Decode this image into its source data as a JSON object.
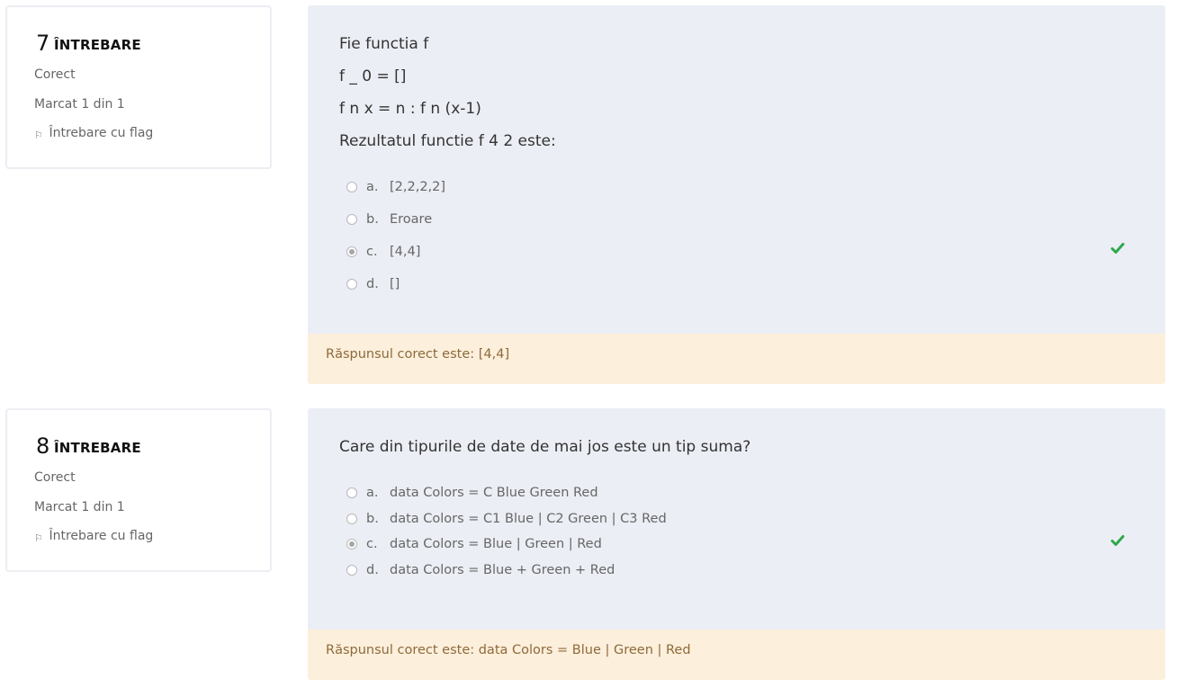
{
  "questions": [
    {
      "number": "7",
      "word": "ÎNTREBARE",
      "state": "Corect",
      "grade": "Marcat 1 din 1",
      "flag_label": "Întrebare cu flag",
      "text_lines": [
        "Fie functia f",
        "f _ 0 = []",
        "f n x = n : f n (x-1)",
        "Rezultatul functie f 4 2 este:"
      ],
      "answers": [
        {
          "letter": "a.",
          "text": "[2,2,2,2]",
          "checked": false
        },
        {
          "letter": "b.",
          "text": "Eroare",
          "checked": false
        },
        {
          "letter": "c.",
          "text": "[4,4]",
          "checked": true
        },
        {
          "letter": "d.",
          "text": "[]",
          "checked": false
        }
      ],
      "feedback": "Răspunsul corect este: [4,4]"
    },
    {
      "number": "8",
      "word": "ÎNTREBARE",
      "state": "Corect",
      "grade": "Marcat 1 din 1",
      "flag_label": "Întrebare cu flag",
      "text_lines": [
        "Care din tipurile de date de mai jos este un tip suma?"
      ],
      "answers": [
        {
          "letter": "a.",
          "text": "data Colors = C Blue Green Red",
          "checked": false
        },
        {
          "letter": "b.",
          "text": "data Colors = C1 Blue | C2 Green | C3 Red",
          "checked": false
        },
        {
          "letter": "c.",
          "text": "data Colors = Blue | Green | Red",
          "checked": true
        },
        {
          "letter": "d.",
          "text": "data Colors = Blue + Green + Red",
          "checked": false
        }
      ],
      "feedback": "Răspunsul corect este: data Colors = Blue | Green | Red"
    }
  ],
  "icons": {
    "flag": "flag-icon",
    "correct": "check-icon"
  },
  "colors": {
    "content_bg": "#eceef5",
    "feedback_bg": "#fcefdc",
    "feedback_text": "#8e6a3a",
    "correct_green": "#2ea84a"
  }
}
